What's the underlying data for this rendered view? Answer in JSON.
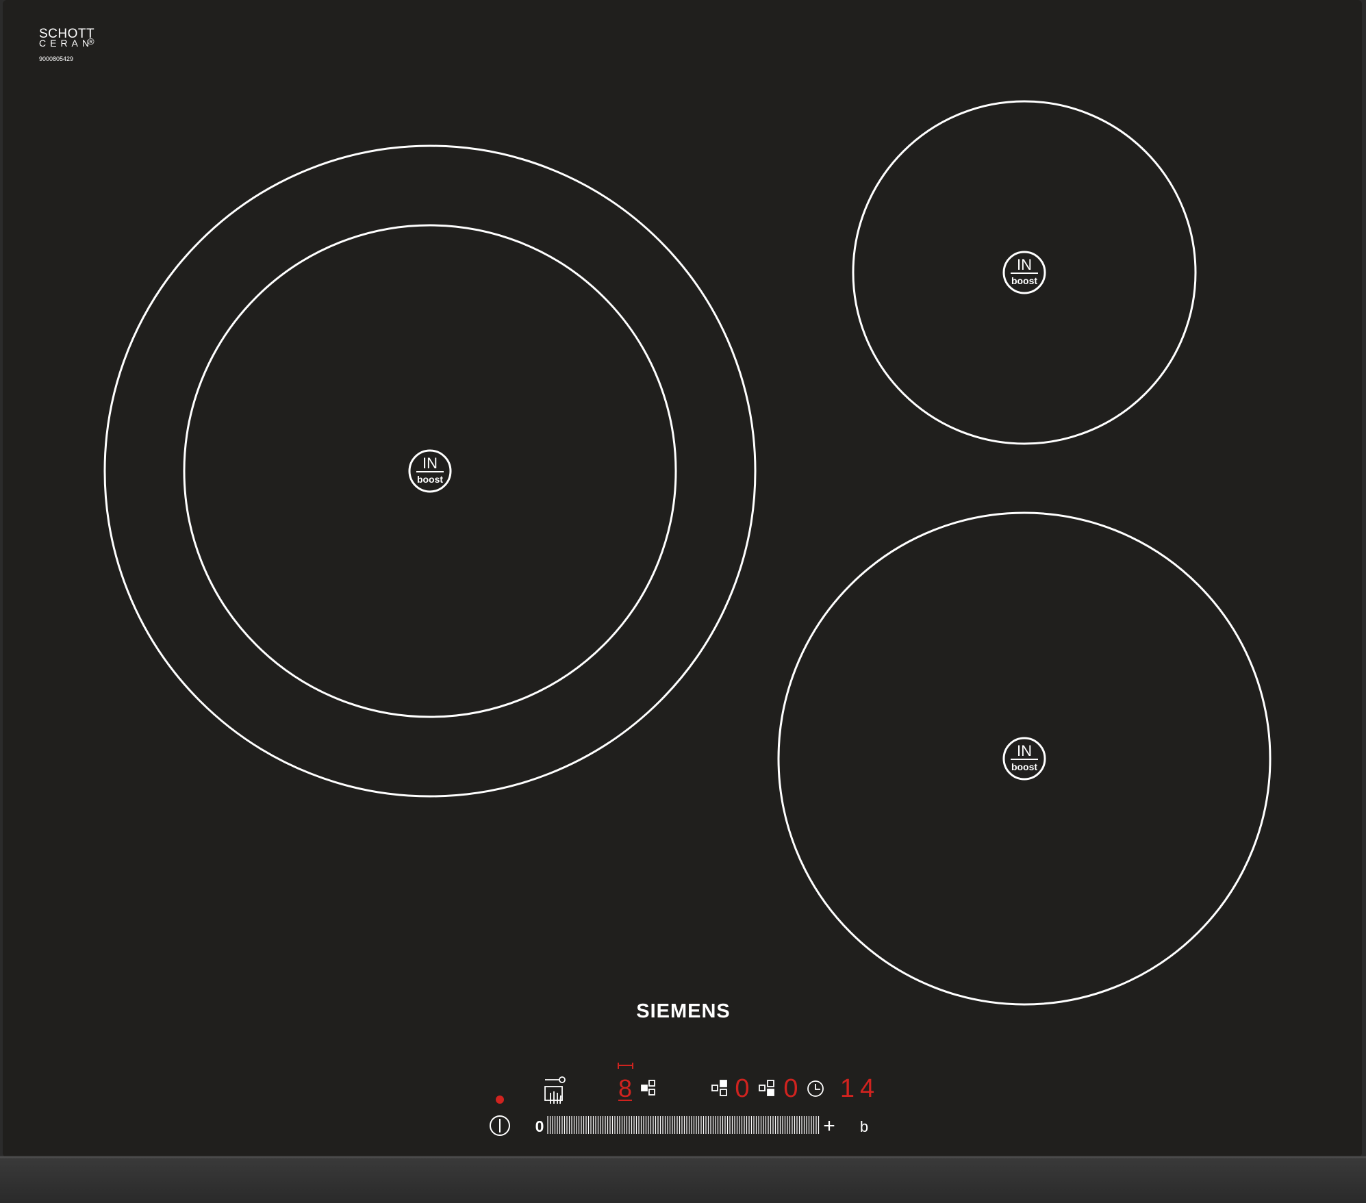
{
  "brand": {
    "maker": "SIEMENS",
    "glass_line1": "SCHOTT",
    "glass_line2": "CERAN",
    "registered": "®",
    "serial": "9000805429"
  },
  "zones": [
    {
      "id": "front-left",
      "badge_top": "IN",
      "badge_bottom": "boost"
    },
    {
      "id": "rear-right",
      "badge_top": "IN",
      "badge_bottom": "boost"
    },
    {
      "id": "front-right",
      "badge_top": "IN",
      "badge_bottom": "boost"
    }
  ],
  "controls": {
    "slider_min": "0",
    "slider_plus": "+",
    "extra_button": "b",
    "zone_level_1": "0",
    "zone_level_2": "0",
    "timer_display": "14",
    "selected_zone_digit": "8"
  },
  "colors": {
    "glass": "#201f1d",
    "frame": "#3c3c3c",
    "print": "#ffffff",
    "display_red": "#d0231f"
  },
  "icons": [
    "power-icon",
    "child-lock-icon",
    "zone-select-icon",
    "clock-icon",
    "power-indicator-dot"
  ]
}
